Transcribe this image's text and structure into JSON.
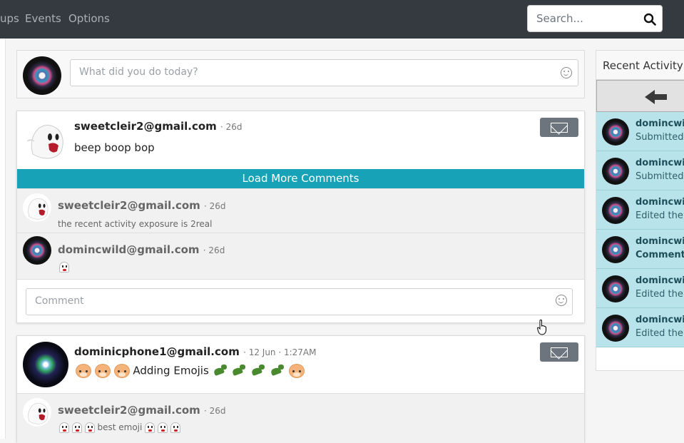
{
  "nav": {
    "items": [
      "ups",
      "Events",
      "Options"
    ],
    "search_placeholder": "Search..."
  },
  "compose": {
    "placeholder": "What did you do today?"
  },
  "posts": [
    {
      "author": "sweetcleir2@gmail.com",
      "time": "· 26d",
      "text": "beep boop bop",
      "load_more": "Load More Comments",
      "comments": [
        {
          "author": "sweetcleir2@gmail.com",
          "time": "· 26d",
          "text": "the recent activity exposure is 2real"
        },
        {
          "author": "domincwild@gmail.com",
          "time": "· 26d",
          "text": ""
        }
      ],
      "comment_placeholder": "Comment"
    },
    {
      "author": "dominicphone1@gmail.com",
      "time": "· 12 Jun · 1:27AM",
      "text": "Adding Emojis",
      "comments": [
        {
          "author": "sweetcleir2@gmail.com",
          "time": "· 26d",
          "text": "best emoji"
        }
      ]
    }
  ],
  "activity": {
    "title": "Recent Activity",
    "items": [
      {
        "name": "domincwild",
        "desc": "Submitted a"
      },
      {
        "name": "domincwild",
        "desc": "Submitted a"
      },
      {
        "name": "domincwild",
        "desc": "Edited their"
      },
      {
        "name": "domincwild",
        "desc": "Commente"
      },
      {
        "name": "domincwild",
        "desc": "Edited their"
      },
      {
        "name": "domincwild",
        "desc": "Edited their"
      }
    ]
  },
  "colors": {
    "nav_bg": "#343a40",
    "accent": "#17a2b8",
    "activity_item_bg": "#b9e3eb",
    "mail_button": "#6c757d"
  }
}
